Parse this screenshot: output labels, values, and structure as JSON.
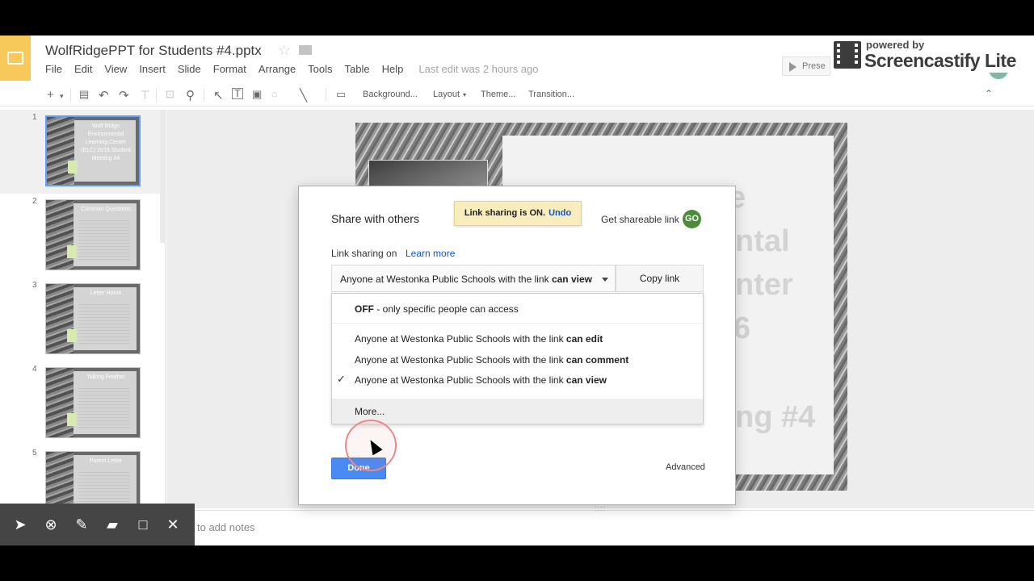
{
  "app": {
    "doc_title": "WolfRidgePPT for Students #4.pptx",
    "menus": [
      "File",
      "Edit",
      "View",
      "Insert",
      "Slide",
      "Format",
      "Arrange",
      "Tools",
      "Table",
      "Help"
    ],
    "last_edit": "Last edit was 2 hours ago",
    "present_label": "Prese"
  },
  "watermark": {
    "small": "powered by",
    "big": "Screencastify Lite"
  },
  "toolbar": {
    "background": "Background...",
    "layout": "Layout",
    "theme": "Theme...",
    "transition": "Transition..."
  },
  "filmstrip": [
    {
      "num": "1",
      "title": "Wolf Ridge Environmental Learning Center (ELC) 2016 Student Meeting #4"
    },
    {
      "num": "2",
      "title": "Common Questions"
    },
    {
      "num": "3",
      "title": "Letter Home"
    },
    {
      "num": "4",
      "title": "Talking Feather"
    },
    {
      "num": "5",
      "title": "Parent Letter"
    }
  ],
  "slide": {
    "words": [
      "e",
      "ntal",
      "nter",
      "6",
      "ng #4"
    ]
  },
  "notes": {
    "placeholder": "to add notes"
  },
  "dialog": {
    "title": "Share with others",
    "toast_text": "Link sharing is ON.",
    "toast_undo": "Undo",
    "get_link": "Get shareable link",
    "link_icon": "GO",
    "sharing_label": "Link sharing on",
    "learn_more": "Learn more",
    "select_prefix": "Anyone at Westonka Public Schools with the link",
    "select_bold": "can view",
    "copy_link": "Copy link",
    "menu": [
      {
        "bold": "OFF",
        "text": " - only specific people can access",
        "checked": false
      },
      {
        "text": "Anyone at Westonka Public Schools with the link ",
        "bold": "can edit",
        "checked": false
      },
      {
        "text": "Anyone at Westonka Public Schools with the link ",
        "bold": "can comment",
        "checked": false
      },
      {
        "text": "Anyone at Westonka Public Schools with the link ",
        "bold": "can view",
        "checked": true
      }
    ],
    "more": "More...",
    "done": "Done",
    "advanced": "Advanced"
  },
  "colors": {
    "accent": "#4a8af4",
    "toast_bg": "#f9edbe",
    "logo": "#f6c244",
    "link_green": "#4b8b3b"
  }
}
